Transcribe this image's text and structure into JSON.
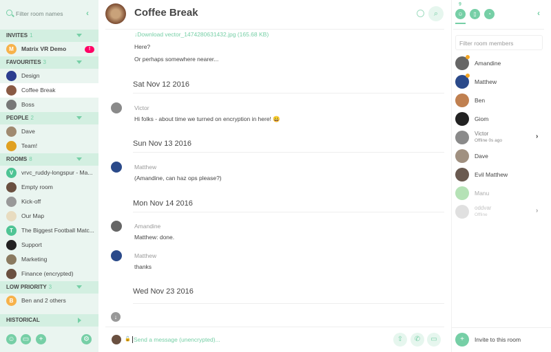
{
  "colors": {
    "accent": "#76cfa6",
    "sidebar_bg": "#eaf5f0",
    "section_bg": "#d3efe1",
    "badge": "#ff0064"
  },
  "sidebar": {
    "filter_placeholder": "Filter room names",
    "sections": [
      {
        "title": "INVITES",
        "count": "1",
        "items": [
          {
            "name": "Matrix VR Demo",
            "letter": "M",
            "color": "#f7b24a",
            "bold": true,
            "badge": "!"
          }
        ]
      },
      {
        "title": "FAVOURITES",
        "count": "3",
        "items": [
          {
            "name": "Design",
            "color": "#2b3d8f"
          },
          {
            "name": "Coffee Break",
            "color": "#8a5a44",
            "selected": true
          },
          {
            "name": "Boss",
            "color": "#777"
          }
        ]
      },
      {
        "title": "PEOPLE",
        "count": "2",
        "items": [
          {
            "name": "Dave",
            "color": "#a08a70"
          },
          {
            "name": "Team!",
            "color": "#e0a020"
          }
        ]
      },
      {
        "title": "ROOMS",
        "count": "8",
        "items": [
          {
            "name": "vrvc_ruddy-longspur - Ma...",
            "letter": "V",
            "color": "#4fc494"
          },
          {
            "name": "Empty room",
            "color": "#6a5040"
          },
          {
            "name": "Kick-off",
            "color": "#999"
          },
          {
            "name": "Our Map",
            "color": "#e8dcc0"
          },
          {
            "name": "The Biggest Football Matc...",
            "letter": "T",
            "color": "#4fc494"
          },
          {
            "name": "Support",
            "color": "#222"
          },
          {
            "name": "Marketing",
            "color": "#8a7a60"
          },
          {
            "name": "Finance (encrypted)",
            "color": "#6a5040"
          }
        ]
      },
      {
        "title": "LOW PRIORITY",
        "count": "3",
        "items": [
          {
            "name": "Ben and 2 others",
            "letter": "B",
            "color": "#f7b24a"
          }
        ]
      }
    ],
    "historical": "HISTORICAL",
    "bottom_icons": [
      "start-chat-icon",
      "room-directory-icon",
      "create-room-icon",
      "settings-icon"
    ]
  },
  "room": {
    "title": "Coffee Break",
    "messages": [
      {
        "type": "link",
        "text": "↓Download vector_1474280631432.jpg (165.68 KB)"
      },
      {
        "type": "text",
        "text": "Here?"
      },
      {
        "type": "text",
        "text": "Or perhaps somewhere nearer..."
      },
      {
        "type": "date",
        "text": "Sat Nov 12 2016"
      },
      {
        "type": "sender",
        "text": "Victor"
      },
      {
        "type": "text",
        "text": "Hi folks - about time we turned on encryption in here! 😀"
      },
      {
        "type": "date",
        "text": "Sun Nov 13 2016"
      },
      {
        "type": "sender",
        "text": "Matthew"
      },
      {
        "type": "text",
        "text": "(Amandine, can haz ops please?)"
      },
      {
        "type": "date",
        "text": "Mon Nov 14 2016"
      },
      {
        "type": "sender",
        "text": "Amandine"
      },
      {
        "type": "text",
        "text": "Matthew: done."
      },
      {
        "type": "sender",
        "text": "Matthew"
      },
      {
        "type": "text",
        "text": "thanks"
      },
      {
        "type": "date",
        "text": "Wed Nov 23 2016"
      }
    ],
    "composer_placeholder": "Send a message (unencrypted)..."
  },
  "members": {
    "count": "9",
    "filter_placeholder": "Filter room members",
    "list": [
      {
        "name": "Amandine",
        "admin": true,
        "color": "#666"
      },
      {
        "name": "Matthew",
        "admin": true,
        "color": "#2b4a8a"
      },
      {
        "name": "Ben",
        "color": "#c08050"
      },
      {
        "name": "Giom",
        "color": "#222"
      },
      {
        "name": "Victor",
        "status": "Offline 0s ago",
        "color": "#8a8a8a"
      },
      {
        "name": "Dave",
        "color": "#a09080"
      },
      {
        "name": "Evil Matthew",
        "color": "#6a5a50"
      },
      {
        "name": "Manu",
        "offline": true,
        "color": "#5cc060"
      },
      {
        "name": "oddvar",
        "status": "Offline",
        "offline": true,
        "color": "#bbb"
      }
    ],
    "invite_label": "Invite to this room"
  }
}
